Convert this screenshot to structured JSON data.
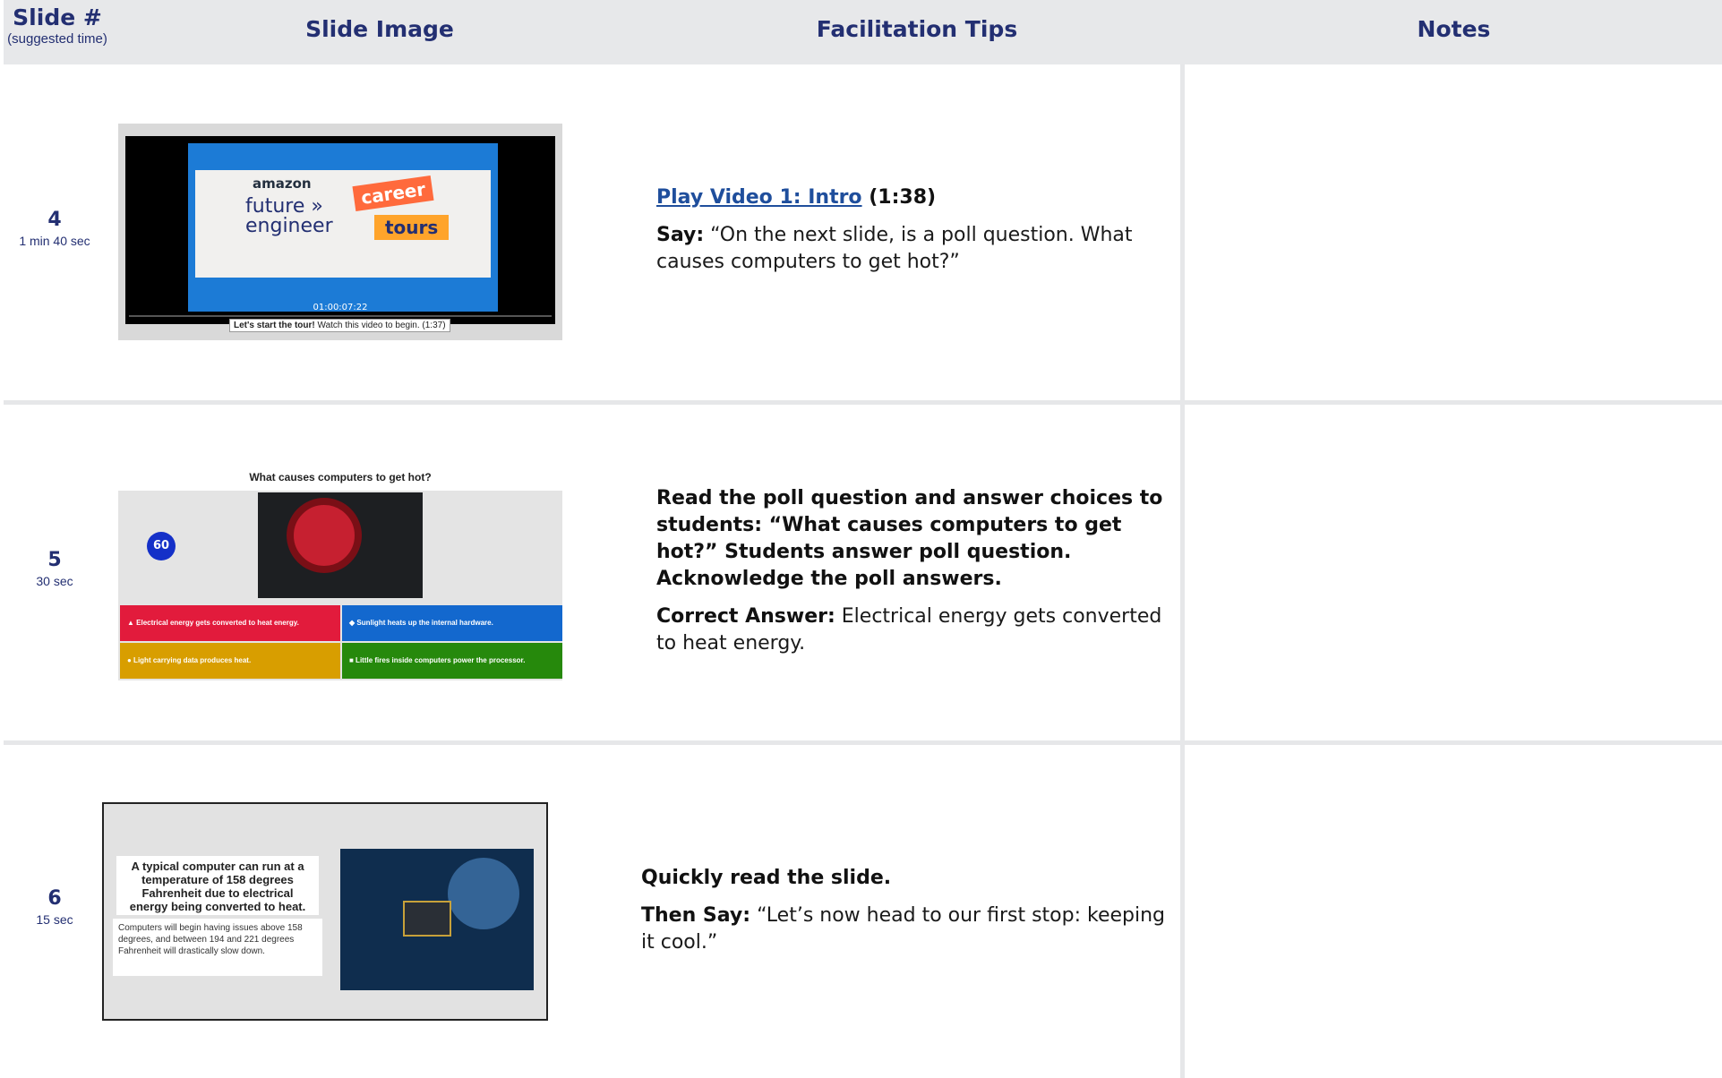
{
  "header": {
    "slide_label": "Slide #",
    "slide_sub": "(suggested time)",
    "image_label": "Slide Image",
    "tips_label": "Facilitation Tips",
    "notes_label": "Notes"
  },
  "rows": [
    {
      "num": "4",
      "time": "1 min 40 sec",
      "thumb": {
        "logo_amazon": "amazon",
        "logo_future": "future »",
        "logo_engineer": "engineer",
        "career": "career",
        "tours": "tours",
        "timecode": "01:00:07:22",
        "caption_bold": "Let's start the tour!",
        "caption_rest": " Watch this video to begin. (1:37)"
      },
      "tips": {
        "link": "Play Video 1: Intro",
        "duration": " (1:38)",
        "say_label": "Say:",
        "say_text": " “On the next slide, is a poll question. What causes computers to get hot?”"
      }
    },
    {
      "num": "5",
      "time": "30 sec",
      "thumb": {
        "question": "What causes computers to get hot?",
        "timer": "60",
        "a1": "▲  Electrical energy gets converted to heat energy.",
        "a2": "◆  Sunlight heats up the internal hardware.",
        "a3": "●  Light carrying data produces heat.",
        "a4": "■  Little fires inside computers power the processor."
      },
      "tips": {
        "instruction": "Read the poll question and answer choices to students: “What causes computers to get hot?” Students answer poll question. Acknowledge the poll answers.",
        "answer_label": "Correct Answer:",
        "answer_text": " Electrical energy gets converted to heat energy."
      }
    },
    {
      "num": "6",
      "time": "15 sec",
      "thumb": {
        "card1": "A typical computer can run at a temperature of 158 degrees Fahrenheit due to electrical energy being converted to heat.",
        "card2": "Computers will begin having issues above 158 degrees, and between 194 and 221 degrees Fahrenheit will drastically slow down."
      },
      "tips": {
        "instruction": "Quickly read the slide.",
        "say_label": "Then Say:",
        "say_text": " “Let’s now head to our first stop: keeping it cool.”"
      }
    }
  ]
}
